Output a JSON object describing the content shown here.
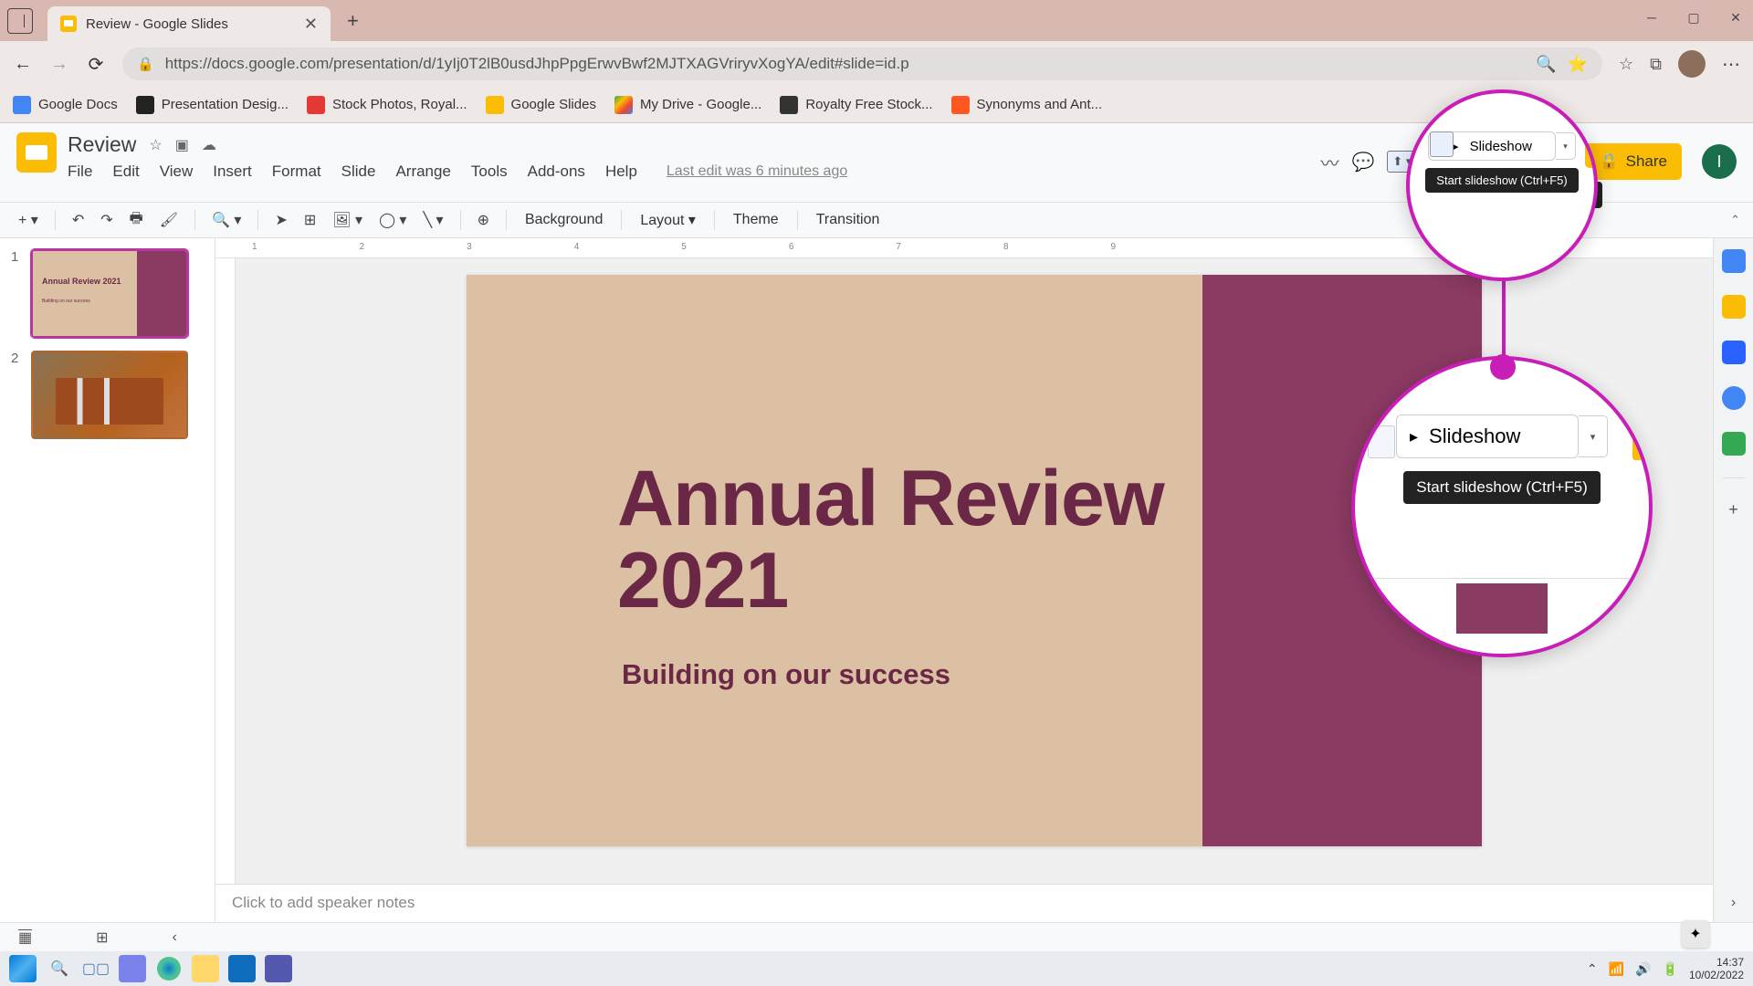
{
  "browser": {
    "tab_title": "Review - Google Slides",
    "url": "https://docs.google.com/presentation/d/1yIj0T2lB0usdJhpPpgErwvBwf2MJTXAGVriryvXogYA/edit#slide=id.p"
  },
  "bookmarks": [
    {
      "label": "Google Docs",
      "color": "#4285f4"
    },
    {
      "label": "Presentation Desig...",
      "color": "#222"
    },
    {
      "label": "Stock Photos, Royal...",
      "color": "#e53935"
    },
    {
      "label": "Google Slides",
      "color": "#fbbc04"
    },
    {
      "label": "My Drive - Google...",
      "color": "#34a853"
    },
    {
      "label": "Royalty Free Stock...",
      "color": "#333"
    },
    {
      "label": "Synonyms and Ant...",
      "color": "#ff5722"
    }
  ],
  "doc": {
    "title": "Review",
    "last_edit": "Last edit was 6 minutes ago"
  },
  "menus": [
    "File",
    "Edit",
    "View",
    "Insert",
    "Format",
    "Slide",
    "Arrange",
    "Tools",
    "Add-ons",
    "Help"
  ],
  "header": {
    "slideshow_label": "Slideshow",
    "share_label": "Share",
    "profile_initial": "I"
  },
  "tooltip": "Start slideshow (Ctrl+F5)",
  "toolbar": {
    "background": "Background",
    "layout": "Layout",
    "theme": "Theme",
    "transition": "Transition"
  },
  "slides": [
    {
      "num": "1"
    },
    {
      "num": "2"
    }
  ],
  "slide_content": {
    "title_line1": "Annual Review",
    "title_line2": "2021",
    "subtitle": "Building on our success"
  },
  "thumb1": {
    "title": "Annual Review 2021",
    "sub": "Building on our success"
  },
  "notes_placeholder": "Click to add speaker notes",
  "ruler_marks": [
    "1",
    "2",
    "3",
    "4",
    "5",
    "6",
    "7",
    "8",
    "9"
  ],
  "tray": {
    "time": "14:37",
    "date": "10/02/2022"
  },
  "magnifier": {
    "slideshow_label": "Slideshow",
    "tooltip": "Start slideshow (Ctrl+F5)"
  }
}
